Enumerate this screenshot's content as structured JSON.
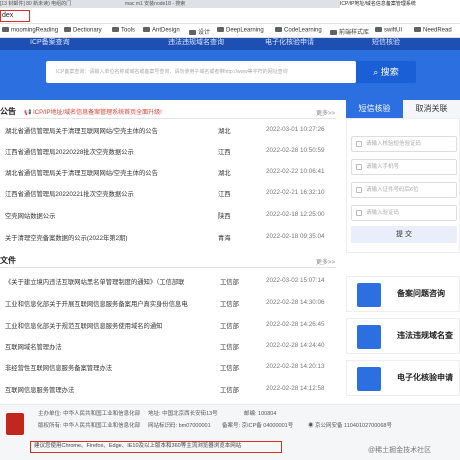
{
  "browser": {
    "tabs": [
      {
        "label": "[13 封邮件] 80 新未读) 电组的门"
      },
      {
        "label": "mac m1 安装node18 - 搜索"
      },
      {
        "label": "ICP/IP地址/域名信息备案管理系统"
      }
    ],
    "url": "dex",
    "bookmarks": [
      "moomingReading",
      "Dectionary",
      "Tools",
      "AntDesign",
      "设计",
      "DeepLearning",
      "CodeLearning",
      "前端样式库",
      "swiftUI",
      "NeedRead"
    ]
  },
  "nav": {
    "items": [
      "ICP备案查询",
      "违法违规域名查询",
      "电子化核验申请",
      "短信核验"
    ]
  },
  "search": {
    "placeholder": "ICP备案查询：请输入单位名称或域名或备案号查询，请勿使用子域名或者带http://www等字符的网址查询",
    "button": "搜索"
  },
  "announcement": {
    "title": "公告",
    "notice": "ICP/IP地址/域名信息备案管理系统首页全面升级!",
    "more": "更多>>",
    "items": [
      {
        "title": "湖北省通信管理局关于清理互联网网站/空壳主体的公告",
        "province": "湖北",
        "date": "2022-03-01 10:27:26"
      },
      {
        "title": "江西省通信管理局20220228批次空壳数据公示",
        "province": "江西",
        "date": "2022-02-28 10:50:59"
      },
      {
        "title": "湖北省通信管理局关于清理互联网网站/空壳主体的公告",
        "province": "湖北",
        "date": "2022-02-22 10:06:41"
      },
      {
        "title": "江西省通信管理局20220221批次空壳数据公示",
        "province": "江西",
        "date": "2022-02-21 16:32:10"
      },
      {
        "title": "空壳网站数据公示",
        "province": "陕西",
        "date": "2022-02-18 12:25:00"
      },
      {
        "title": "关于清理空壳备案数据的公示(2022年第2期)",
        "province": "青海",
        "date": "2022-02-18 09:35:04"
      }
    ]
  },
  "documents": {
    "title": "文件",
    "more": "更多>>",
    "items": [
      {
        "title": "《关于建立境内违法互联网站黑名单管理制度的通知》（工信部联",
        "dept": "工信部",
        "date": "2022-03-02 15:07:14"
      },
      {
        "title": "工业和信息化部关于开展互联网信息服务备案用户真实身份信息电",
        "dept": "工信部",
        "date": "2022-02-28 14:30:06"
      },
      {
        "title": "工业和信息化部关于规范互联网信息服务使用域名的通知",
        "dept": "工信部",
        "date": "2022-02-28 14:26:45"
      },
      {
        "title": "互联网域名管理办法",
        "dept": "工信部",
        "date": "2022-02-28 14:24:40"
      },
      {
        "title": "非经营性互联网信息服务备案管理办法",
        "dept": "工信部",
        "date": "2022-02-28 14:20:13"
      },
      {
        "title": "互联网信息服务管理办法",
        "dept": "工信部",
        "date": "2022-02-28 14:12:58"
      }
    ]
  },
  "sms": {
    "tab_active": "短信核验",
    "tab_other": "取消关联",
    "fields": [
      "请输入核验短信验证码",
      "请输入手机号",
      "请输入证件号码后6位",
      "请输入验证码"
    ],
    "submit": "提 交"
  },
  "services": [
    "备案问题咨询",
    "违法违规域名查",
    "电子化核验申请"
  ],
  "footer": {
    "host_label": "主办单位:",
    "host": "中华人民共和国工业和信息化部",
    "address_label": "地址:",
    "address": "中国北京西长安街13号",
    "zip_label": "邮编:",
    "zip": "100804",
    "copyright_label": "版权所有:",
    "copyright": "中华人民共和国工业和信息化部",
    "site_id_label": "网站标识码:",
    "site_id": "bm07000001",
    "icp_label": "备案号:",
    "icp": "京ICP备 04000001号",
    "police": "京公网安备 11040102700068号",
    "notice": "建议您使用Chrome、Firefox、Edge、IE10及以上版本和360等主流浏览器浏览本网站",
    "watermark": "@稀土掘金技术社区"
  }
}
